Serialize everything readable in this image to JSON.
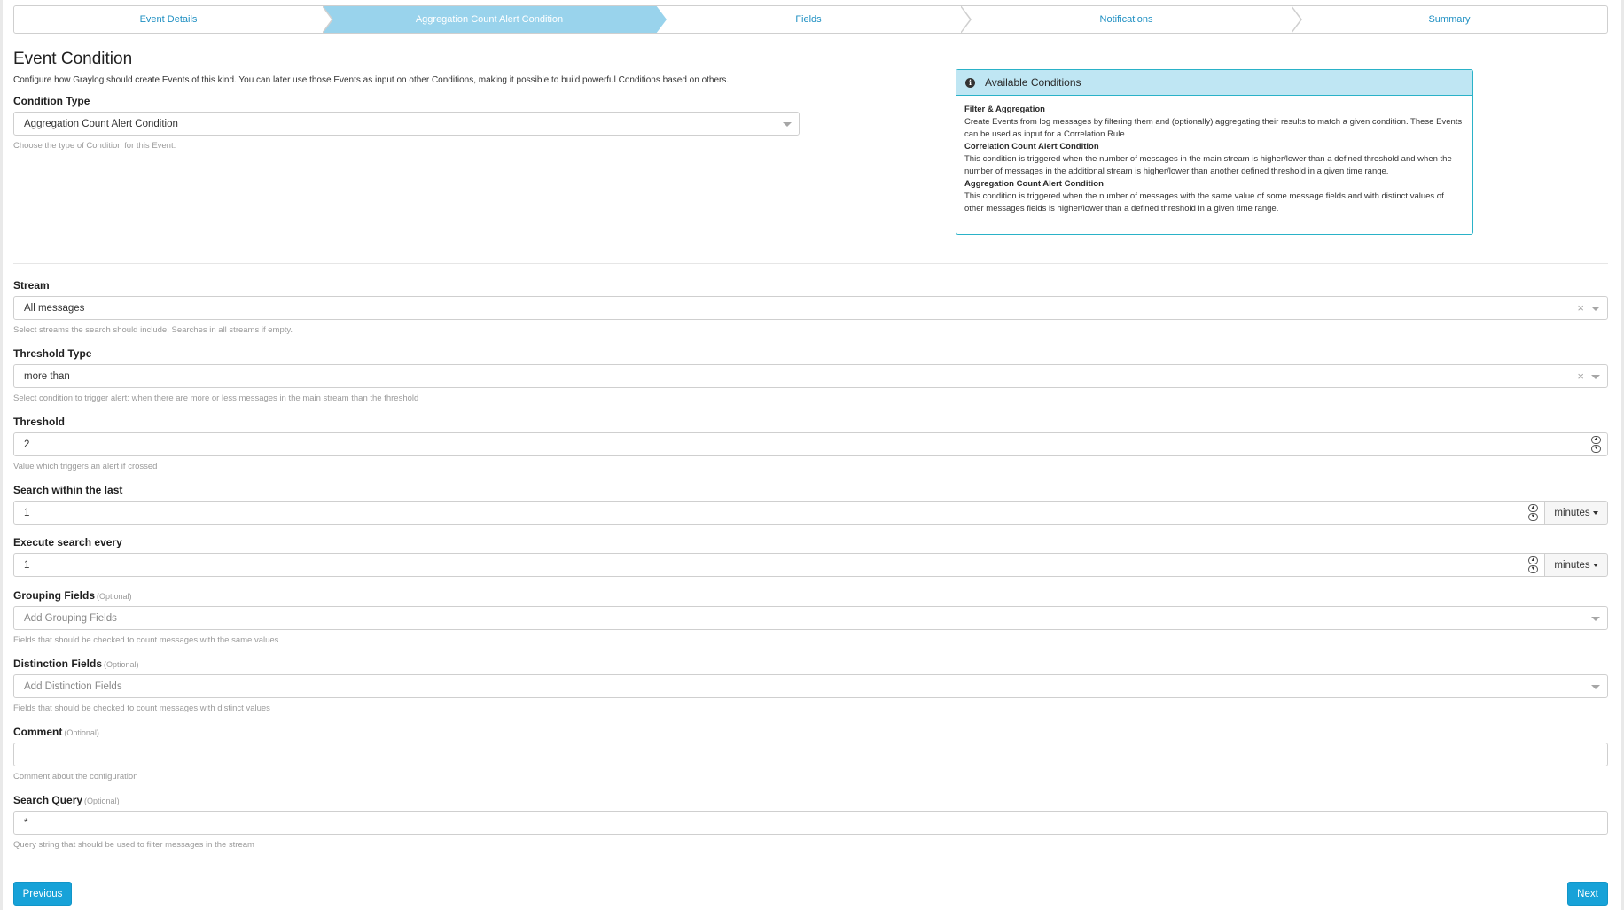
{
  "wizard": {
    "steps": [
      {
        "label": "Event Details"
      },
      {
        "label": "Aggregation Count Alert Condition"
      },
      {
        "label": "Fields"
      },
      {
        "label": "Notifications"
      },
      {
        "label": "Summary"
      }
    ],
    "active_step": "Aggregation Count Alert Condition"
  },
  "condition": {
    "title": "Event Condition",
    "description": "Configure how Graylog should create Events of this kind. You can later use those Events as input on other Conditions, making it possible to build powerful Conditions based on others.",
    "type_label": "Condition Type",
    "type_value": "Aggregation Count Alert Condition",
    "type_help": "Choose the type of Condition for this Event."
  },
  "available_conditions": {
    "title": "Available Conditions",
    "items": [
      {
        "name": "Filter & Aggregation",
        "text": "Create Events from log messages by filtering them and (optionally) aggregating their results to match a given condition. These Events can be used as input for a Correlation Rule."
      },
      {
        "name": "Correlation Count Alert Condition",
        "text": "This condition is triggered when the number of messages in the main stream is higher/lower than a defined threshold and when the number of messages in the additional stream is higher/lower than another defined threshold in a given time range."
      },
      {
        "name": "Aggregation Count Alert Condition",
        "text": "This condition is triggered when the number of messages with the same value of some message fields and with distinct values of other messages fields is higher/lower than a defined threshold in a given time range."
      }
    ]
  },
  "form": {
    "stream": {
      "label": "Stream",
      "value": "All messages",
      "help": "Select streams the search should include. Searches in all streams if empty."
    },
    "threshold_type": {
      "label": "Threshold Type",
      "value": "more than",
      "help": "Select condition to trigger alert: when there are more or less messages in the main stream than the threshold"
    },
    "threshold": {
      "label": "Threshold",
      "value": "2",
      "help": "Value which triggers an alert if crossed"
    },
    "search_within": {
      "label": "Search within the last",
      "value": "1",
      "unit": "minutes"
    },
    "execute_every": {
      "label": "Execute search every",
      "value": "1",
      "unit": "minutes"
    },
    "grouping_fields": {
      "label": "Grouping Fields",
      "optional": "(Optional)",
      "placeholder": "Add Grouping Fields",
      "help": "Fields that should be checked to count messages with the same values"
    },
    "distinction_fields": {
      "label": "Distinction Fields",
      "optional": "(Optional)",
      "placeholder": "Add Distinction Fields",
      "help": "Fields that should be checked to count messages with distinct values"
    },
    "comment": {
      "label": "Comment",
      "optional": "(Optional)",
      "value": "",
      "help": "Comment about the configuration"
    },
    "search_query": {
      "label": "Search Query",
      "optional": "(Optional)",
      "value": "*",
      "help": "Query string that should be used to filter messages in the stream"
    }
  },
  "buttons": {
    "previous": "Previous",
    "next": "Next"
  },
  "colors": {
    "accent": "#17a2d8",
    "active_step": "#99d3ec",
    "info_border": "#2ab2c8",
    "info_header": "#bfe6f3"
  },
  "icons": {
    "info": "info-circle-icon",
    "caret": "caret-down-icon",
    "clear": "clear-x-icon",
    "spinner": "number-spinner-icon"
  }
}
